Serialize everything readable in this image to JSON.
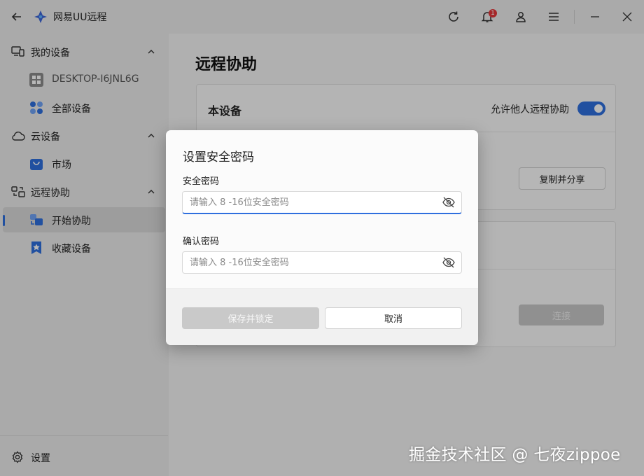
{
  "window": {
    "title": "网易UU远程",
    "notification_count": "1"
  },
  "sidebar": {
    "groups": [
      {
        "label": "我的设备",
        "items": [
          {
            "label": "DESKTOP-I6JNL6G"
          },
          {
            "label": "全部设备"
          }
        ]
      },
      {
        "label": "云设备",
        "items": [
          {
            "label": "市场"
          }
        ]
      },
      {
        "label": "远程协助",
        "items": [
          {
            "label": "开始协助",
            "active": true
          },
          {
            "label": "收藏设备"
          }
        ]
      }
    ],
    "settings_label": "设置"
  },
  "main": {
    "title": "远程协助",
    "this_device": {
      "title": "本设备",
      "allow_label": "允许他人远程协助",
      "allow_enabled": true,
      "copy_share_label": "复制并分享"
    },
    "connect_label": "连接"
  },
  "dialog": {
    "title": "设置安全密码",
    "password_label": "安全密码",
    "password_placeholder": "请输入 8 -16位安全密码",
    "confirm_label": "确认密码",
    "confirm_placeholder": "请输入 8 -16位安全密码",
    "save_label": "保存并锁定",
    "cancel_label": "取消"
  },
  "watermark": "掘金技术社区 @ 七夜zippoe",
  "colors": {
    "accent": "#2f6fde",
    "badge": "#e5373a"
  },
  "icons": [
    "back-arrow-icon",
    "app-logo-icon",
    "refresh-icon",
    "bell-icon",
    "user-icon",
    "menu-icon",
    "minimize-icon",
    "close-icon",
    "monitor-icon",
    "windows-icon",
    "apps-grid-icon",
    "cloud-icon",
    "shopping-bag-icon",
    "remote-assist-icon",
    "star-bookmark-icon",
    "chevron-up-icon",
    "gear-icon",
    "eye-off-icon"
  ]
}
